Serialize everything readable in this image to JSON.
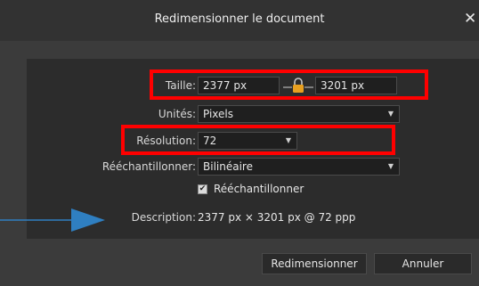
{
  "dialog": {
    "title": "Redimensionner le document",
    "close_glyph": "✕"
  },
  "size": {
    "label": "Taille:",
    "width_value": "2377 px",
    "height_value": "3201 px",
    "lock_icon": "padlock-icon"
  },
  "units": {
    "label": "Unités:",
    "value": "Pixels"
  },
  "resolution": {
    "label": "Résolution:",
    "value": "72"
  },
  "resample": {
    "label": "Rééchantillonner:",
    "value": "Bilinéaire",
    "checkbox_label": "Rééchantillonner",
    "checked": true
  },
  "description": {
    "label": "Description:",
    "value": "2377 px × 3201 px @ 72 ppp"
  },
  "buttons": {
    "resize_label": "Redimensionner",
    "cancel_label": "Annuler"
  },
  "colors": {
    "highlight": "#ff0000",
    "arrow": "#2f7fc1",
    "lock": "#e8a020"
  }
}
